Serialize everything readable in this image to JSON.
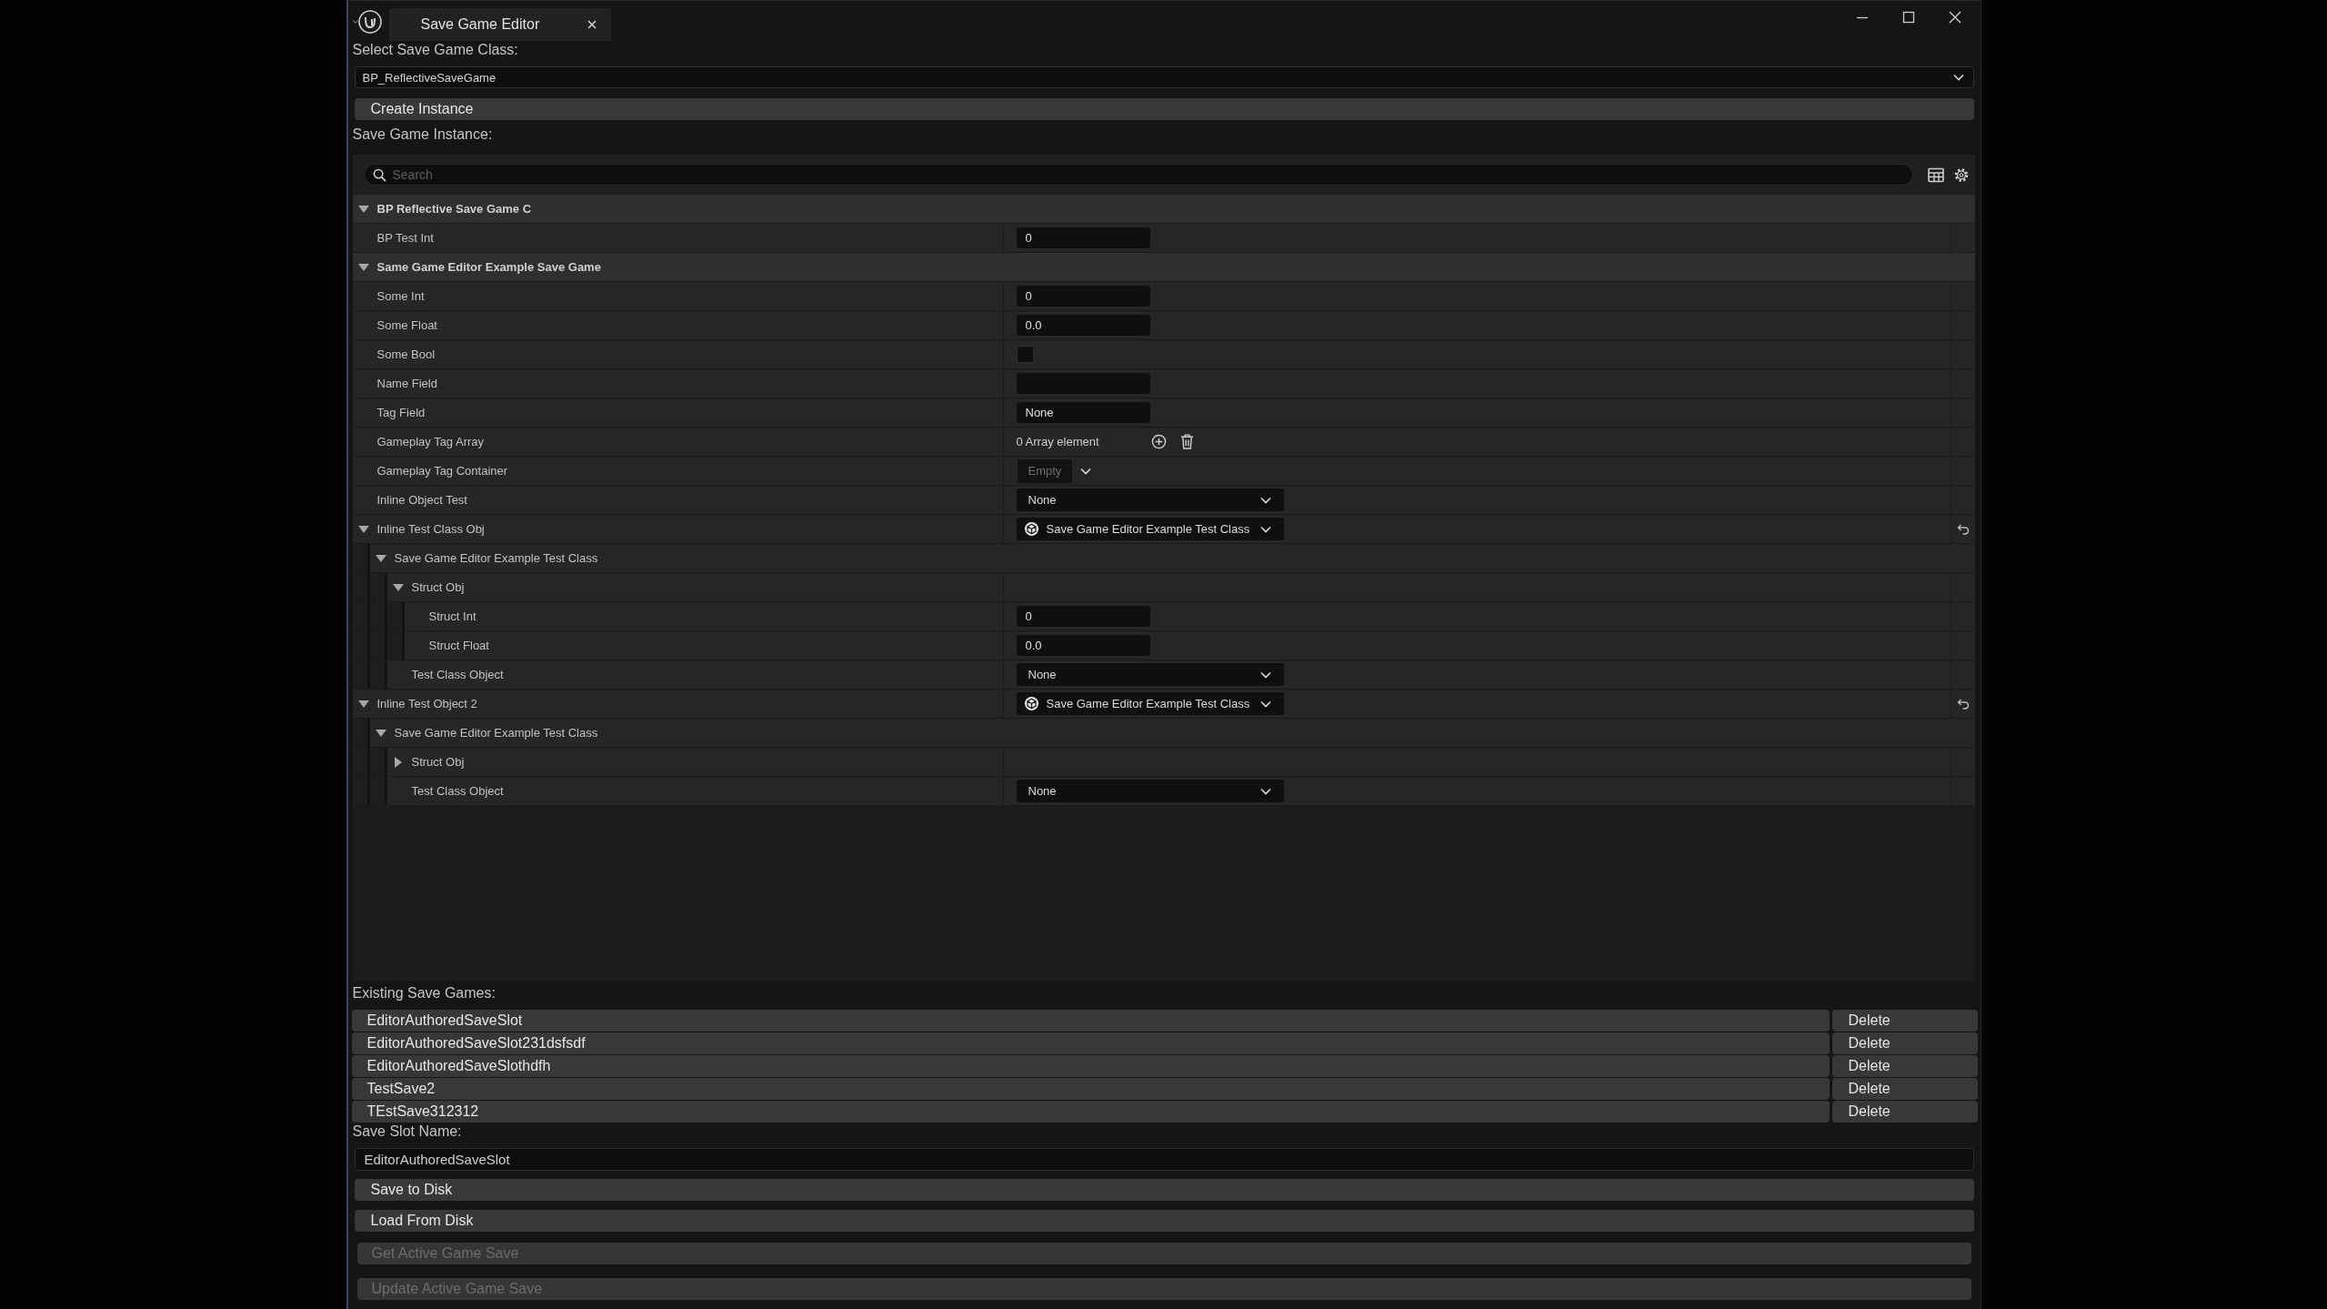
{
  "window": {
    "title": "Save Game Editor"
  },
  "class_picker": {
    "label": "Select Save Game Class:",
    "value": "BP_ReflectiveSaveGame"
  },
  "create_button": {
    "label": "Create Instance"
  },
  "instance": {
    "label": "Save Game Instance:",
    "search": {
      "placeholder": "Search"
    },
    "properties": [
      {
        "kind": "category",
        "name": "BP Reflective Save Game C",
        "expanded": true,
        "children": [
          {
            "kind": "text",
            "name": "BP Test Int",
            "value": "0"
          }
        ]
      },
      {
        "kind": "category",
        "name": "Same Game Editor Example Save Game",
        "expanded": true,
        "children": [
          {
            "kind": "text",
            "name": "Some Int",
            "value": "0"
          },
          {
            "kind": "text",
            "name": "Some Float",
            "value": "0.0"
          },
          {
            "kind": "checkbox",
            "name": "Some Bool",
            "checked": false
          },
          {
            "kind": "text",
            "name": "Name Field"
          },
          {
            "kind": "text",
            "name": "Tag Field",
            "value": "None"
          },
          {
            "kind": "array",
            "name": "Gameplay Tag Array",
            "value": "0 Array element"
          },
          {
            "kind": "tags",
            "name": "Gameplay Tag Container",
            "placeholder": "Empty"
          },
          {
            "kind": "dropdown",
            "name": "Inline Object Test",
            "value": "None"
          },
          {
            "kind": "object",
            "name": "Inline Test Class Obj",
            "value": "Save Game Editor Example Test Class",
            "reset": true,
            "expanded": true,
            "children": [
              {
                "kind": "group",
                "name": "Save Game Editor Example Test Class",
                "expanded": true,
                "children": [
                  {
                    "kind": "struct",
                    "name": "Struct Obj",
                    "expanded": true,
                    "children": [
                      {
                        "kind": "text",
                        "name": "Struct Int",
                        "value": "0"
                      },
                      {
                        "kind": "text",
                        "name": "Struct Float",
                        "value": "0.0"
                      }
                    ]
                  },
                  {
                    "kind": "dropdown",
                    "name": "Test Class Object",
                    "value": "None"
                  }
                ]
              }
            ]
          },
          {
            "kind": "object",
            "name": "Inline Test Object 2",
            "value": "Save Game Editor Example Test Class",
            "reset": true,
            "expanded": true,
            "children": [
              {
                "kind": "group",
                "name": "Save Game Editor Example Test Class",
                "expanded": true,
                "children": [
                  {
                    "kind": "struct",
                    "name": "Struct Obj",
                    "expanded": false
                  },
                  {
                    "kind": "dropdown",
                    "name": "Test Class Object",
                    "value": "None"
                  }
                ]
              }
            ]
          }
        ]
      }
    ]
  },
  "existing_saves": {
    "label": "Existing Save Games:",
    "slots": [
      {
        "name": "EditorAuthoredSaveSlot",
        "delete": "Delete"
      },
      {
        "name": "EditorAuthoredSaveSlot231dsfsdf",
        "delete": "Delete"
      },
      {
        "name": "EditorAuthoredSaveSlothdfh",
        "delete": "Delete"
      },
      {
        "name": "TestSave2",
        "delete": "Delete"
      },
      {
        "name": "TEstSave312312",
        "delete": "Delete"
      }
    ]
  },
  "slot_name": {
    "label": "Save Slot Name:",
    "value": "EditorAuthoredSaveSlot"
  },
  "actions": [
    {
      "label": "Save to Disk",
      "disabled": false
    },
    {
      "label": "Load From Disk",
      "disabled": false
    },
    {
      "label": "Get Active Game Save",
      "disabled": true
    },
    {
      "label": "Update Active Game Save",
      "disabled": true
    }
  ]
}
